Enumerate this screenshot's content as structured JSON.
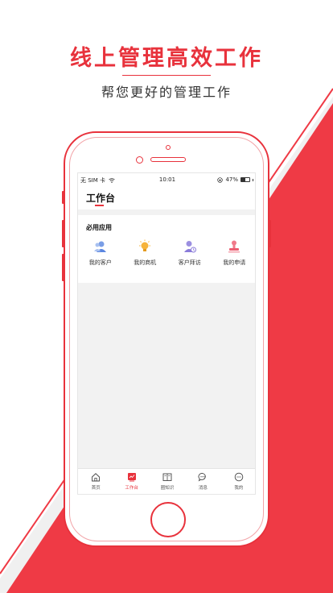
{
  "colors": {
    "accent": "#e8323c",
    "text_dark": "#333333",
    "screen_bg": "#f2f2f2"
  },
  "promo": {
    "headline": "线上管理高效工作",
    "subline": "帮您更好的管理工作"
  },
  "status_bar": {
    "carrier": "无 SIM 卡",
    "time": "10:01",
    "battery": "47%",
    "battery_level": 0.47
  },
  "nav": {
    "title": "工作台"
  },
  "apps_section": {
    "title": "必用应用",
    "items": [
      {
        "label": "我的客户",
        "icon": "customer-icon"
      },
      {
        "label": "我的商机",
        "icon": "lightbulb-icon"
      },
      {
        "label": "客户拜访",
        "icon": "visit-icon"
      },
      {
        "label": "我的申请",
        "icon": "stamp-icon"
      }
    ]
  },
  "tabbar": {
    "items": [
      {
        "label": "首页",
        "icon": "home-icon",
        "active": false
      },
      {
        "label": "工作台",
        "icon": "workbench-icon",
        "active": true
      },
      {
        "label": "圈知识",
        "icon": "book-icon",
        "active": false
      },
      {
        "label": "消息",
        "icon": "message-icon",
        "active": false
      },
      {
        "label": "我的",
        "icon": "profile-icon",
        "active": false
      }
    ]
  }
}
